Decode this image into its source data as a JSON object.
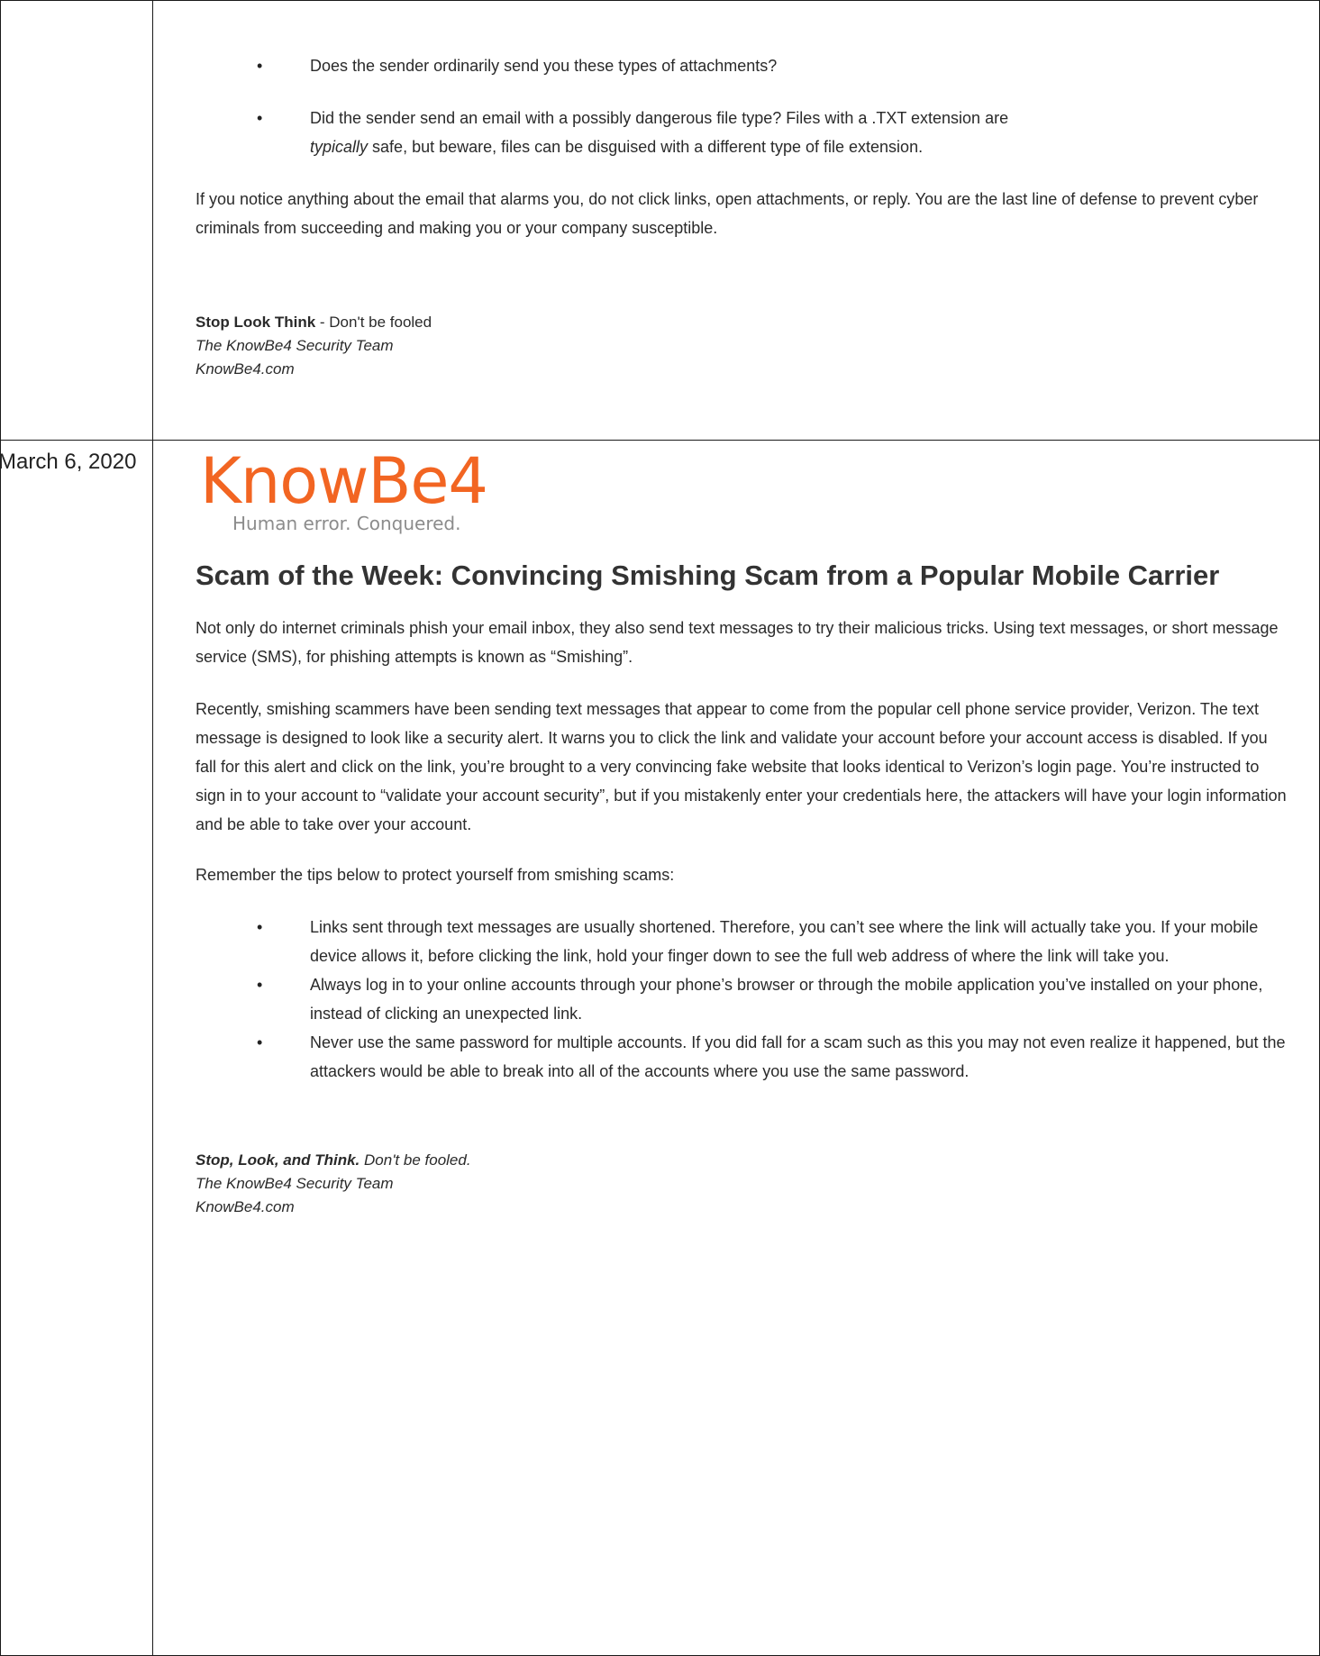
{
  "top_section": {
    "bullets": [
      "Does the sender ordinarily send you these types of attachments?",
      {
        "before": "Did the sender send an email with a possibly dangerous file type? Files with a .TXT extension are",
        "italic": "typically",
        "after": "safe, but beware, files can be disguised with a different type of file extension."
      }
    ],
    "paragraph": "If you notice anything about the email that alarms you, do not click links, open attachments, or reply. You are the last line of defense to prevent cyber criminals from succeeding and making you or your company susceptible.",
    "sign_off": {
      "bold": "Stop Look Think",
      "rest": " - Don't be fooled",
      "team": "The KnowBe4 Security Team",
      "site": "KnowBe4.com"
    }
  },
  "bottom_section": {
    "date": "March 6, 2020",
    "logo": {
      "wordmark": "KnowBe4",
      "tagline": "Human error. Conquered."
    },
    "headline": "Scam of the Week: Convincing Smishing Scam from a Popular Mobile Carrier",
    "paragraphs": [
      "Not only do internet criminals phish your email inbox, they also send text messages to try their malicious tricks. Using text messages, or short message service (SMS), for phishing attempts is known as “Smishing”.",
      "Recently, smishing scammers have been sending text messages that appear to come from the popular cell phone service provider, Verizon. The text message is designed to look like a security alert. It warns you to click the link and validate your account before your account access is disabled. If you fall for this alert and click on the link, you’re brought to a very convincing fake website that looks identical to Verizon’s login page. You’re instructed to sign in to your account to “validate your account security”, but if you mistakenly enter your credentials here, the attackers will have your login information and be able to take over your account.",
      "Remember the tips below to protect yourself from smishing scams:"
    ],
    "tips": [
      "Links sent through text messages are usually shortened. Therefore, you can’t see where the link will actually take you. If your mobile device allows it, before clicking the link, hold your finger down to see the full web address of where the link will take you.",
      "Always log in to your online accounts through your phone’s browser or through the mobile application you’ve installed on your phone, instead of clicking an unexpected link.",
      "Never use the same password for multiple accounts. If you did fall for a scam such as this you may not even realize it happened, but the attackers would be able to break into all of the accounts where you use the same password."
    ],
    "sign_off": {
      "bold": "Stop, Look, and Think.",
      "rest": " Don't be fooled.",
      "team": "The KnowBe4 Security Team",
      "site": "KnowBe4.com"
    }
  }
}
